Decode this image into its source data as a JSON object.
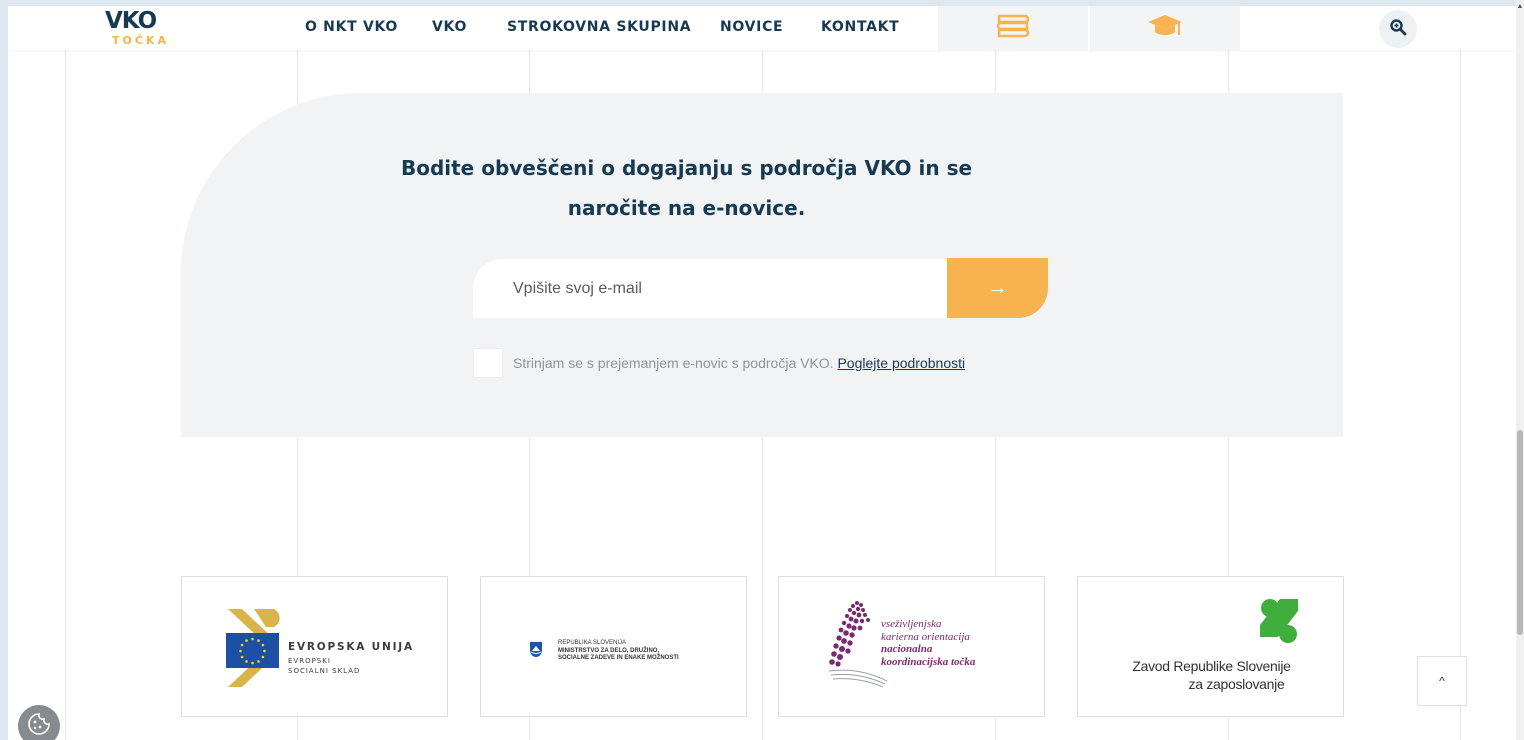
{
  "header": {
    "logo": {
      "main": "VKO",
      "sub": "TOČKA"
    },
    "nav": [
      {
        "label": "O NKT VKO"
      },
      {
        "label": "VKO"
      },
      {
        "label": "STROKOVNA SKUPINA"
      },
      {
        "label": "NOVICE"
      },
      {
        "label": "KONTAKT"
      }
    ],
    "icons": {
      "books": "books-icon",
      "graduation": "graduation-cap-icon",
      "search": "search-zoom-icon"
    }
  },
  "newsletter": {
    "title_line1": "Bodite obveščeni o dogajanju s področja VKO in se",
    "title_line2": "naročite na e-novice.",
    "email_placeholder": "Vpišite svoj e-mail",
    "submit_icon": "→",
    "consent_text": "Strinjam se s prejemanjem e-novic s področja VKO.",
    "consent_link": "Poglejte podrobnosti",
    "consent_checked": false
  },
  "partners": {
    "eu": {
      "title": "EVROPSKA UNIJA",
      "line1": "EVROPSKI",
      "line2": "SOCIALNI SKLAD"
    },
    "ministry": {
      "line1": "REPUBLIKA SLOVENIJA",
      "line2": "MINISTRSTVO ZA DELO, DRUŽINO,",
      "line3": "SOCIALNE ZADEVE IN ENAKE MOŽNOSTI"
    },
    "ncot": {
      "line1": "vseživljenjska",
      "line2": "karierna orientacija",
      "line3": "nacionalna",
      "line4": "koordinacijska točka"
    },
    "zrs": {
      "line1": "Zavod Republike Slovenije",
      "line2": "za zaposlovanje"
    }
  },
  "controls": {
    "back_to_top": "^",
    "cookie": "cookie-icon"
  },
  "colors": {
    "navy": "#173a52",
    "accent": "#f6b350",
    "panel": "#f2f3f4"
  }
}
